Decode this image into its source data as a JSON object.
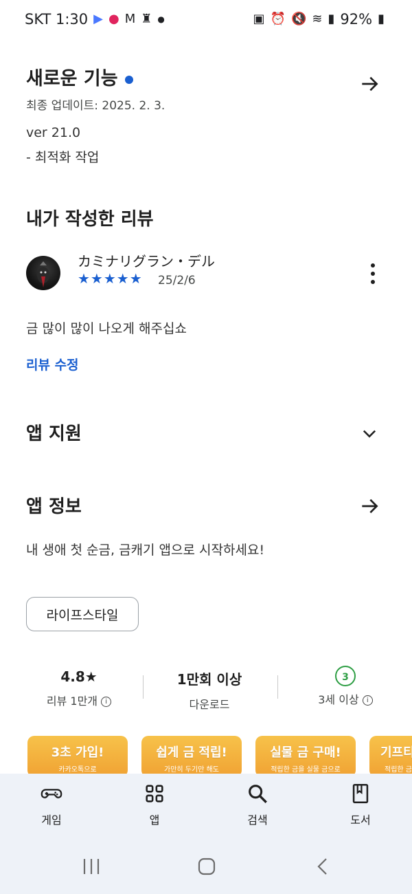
{
  "status_bar": {
    "carrier_time": "SKT 1:30",
    "battery": "92%"
  },
  "whats_new": {
    "title": "새로운 기능",
    "updated": "최종 업데이트: 2025. 2. 3.",
    "version": "ver 21.0",
    "note": "- 최적화 작업"
  },
  "my_review": {
    "title": "내가 작성한 리뷰",
    "author": "カミナリグラン・デル",
    "stars": "★★★★★",
    "date": "25/2/6",
    "text": "금 많이 많이 나오게 해주십쇼",
    "edit_label": "리뷰 수정"
  },
  "app_support": {
    "title": "앱 지원"
  },
  "app_info": {
    "title": "앱 정보",
    "description": "내 생애 첫 순금, 금캐기 앱으로 시작하세요!",
    "category": "라이프스타일"
  },
  "stats": {
    "rating": "4.8★",
    "reviews": "리뷰 1만개",
    "downloads": "1만회 이상",
    "downloads_label": "다운로드",
    "age_badge": "3",
    "age_label": "3세 이상"
  },
  "promos": [
    {
      "big": "3초 가입!",
      "small": "카카오톡으로"
    },
    {
      "big": "쉽게 금 적립!",
      "small": "가만히 두기만 해도"
    },
    {
      "big": "실물 금 구매!",
      "small": "적립한 금을 실물 금으로"
    },
    {
      "big": "기프티",
      "small": "적립한 금"
    }
  ],
  "bottom_nav": {
    "games": "게임",
    "apps": "앱",
    "search": "검색",
    "books": "도서"
  },
  "colors": {
    "accent": "#1a5fd0",
    "promo": "#f0a233",
    "age_green": "#2e9e44"
  }
}
